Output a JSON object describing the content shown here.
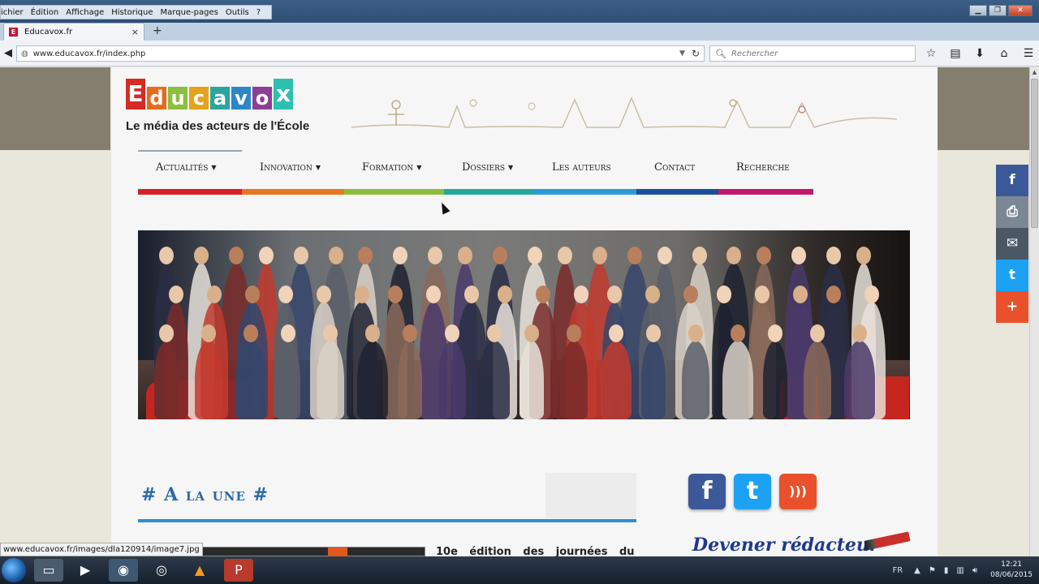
{
  "browser": {
    "menu": [
      "ichier",
      "Édition",
      "Affichage",
      "Historique",
      "Marque-pages",
      "Outils",
      "?"
    ],
    "tab_title": "Educavox.fr",
    "tab_close": "×",
    "new_tab": "+",
    "url": "www.educavox.fr/index.php",
    "search_placeholder": "Rechercher",
    "status_url": "www.educavox.fr/images/dla120914/image7.jpg"
  },
  "site": {
    "logo_letters": [
      "E",
      "d",
      "u",
      "c",
      "a",
      "v",
      "o",
      "x"
    ],
    "tagline": "Le média des acteurs de l'École",
    "nav": [
      {
        "label": "Actualités",
        "caret": "▼"
      },
      {
        "label": "Innovation",
        "caret": "▼"
      },
      {
        "label": "Formation",
        "caret": "▼"
      },
      {
        "label": "Dossiers",
        "caret": "▼"
      },
      {
        "label": "Les auteurs"
      },
      {
        "label": "Contact"
      },
      {
        "label": "Recherche"
      }
    ],
    "section_title": "# A la une #",
    "article_title": "10e édition des journées du",
    "devenir": "Devener rédacteur"
  },
  "colors": {
    "nav_bar": [
      "#d92027",
      "#e87722",
      "#8cbd3a",
      "#24a89a",
      "#2c9ad7",
      "#1c4e9c",
      "#c2186c"
    ],
    "logo": [
      "#d62a25",
      "#e86a1c",
      "#8bbf3c",
      "#e3a31a",
      "#2aa5a0",
      "#2c86c8",
      "#8c3f96",
      "#2fbfb0"
    ],
    "facebook": "#3b5998",
    "twitter": "#1da1f2",
    "email": "#4a5866",
    "print": "#7b8794",
    "plus": "#e8512b"
  },
  "icons": {
    "share": [
      "facebook-icon",
      "print-icon",
      "email-icon",
      "twitter-icon",
      "plus-icon"
    ],
    "share_glyphs": [
      "f",
      "⎙",
      "✉",
      "t",
      "+"
    ],
    "social": [
      "facebook-icon",
      "twitter-icon",
      "rss-icon"
    ],
    "social_glyphs": [
      "f",
      "t",
      ")))"
    ]
  },
  "taskbar": {
    "lang": "FR",
    "time": "12:21",
    "date": "08/06/2015"
  }
}
